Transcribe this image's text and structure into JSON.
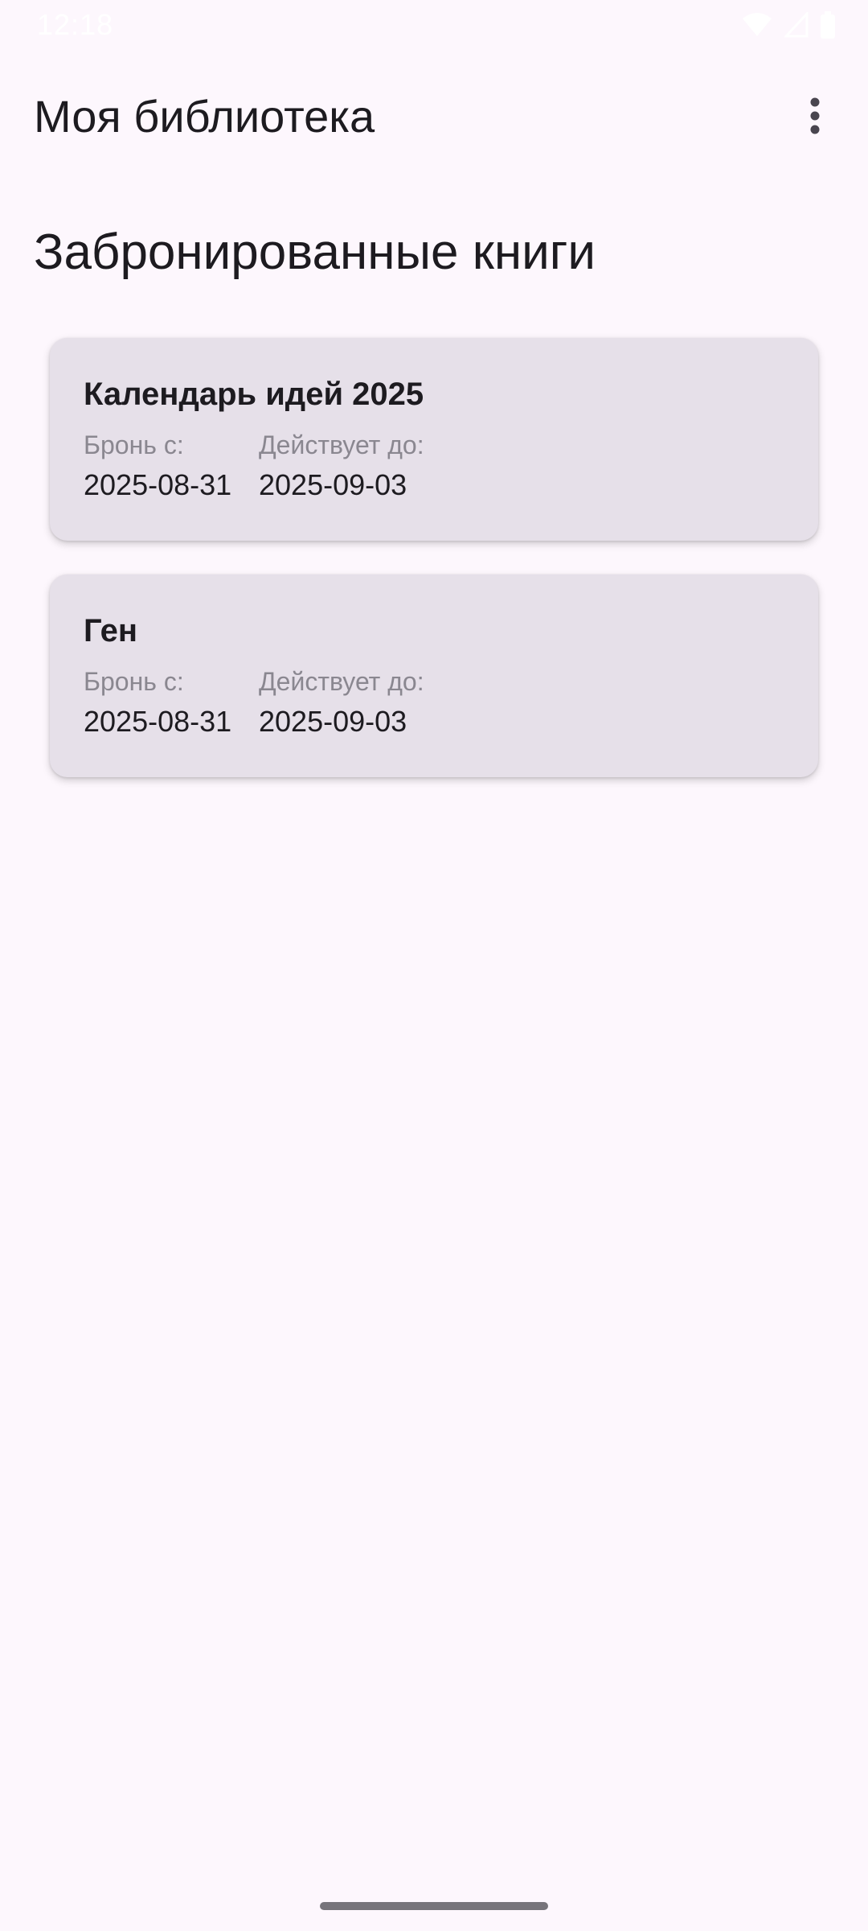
{
  "status_bar": {
    "time": "12:18",
    "icons": [
      "wifi-icon",
      "signal-icon",
      "battery-icon"
    ]
  },
  "app_bar": {
    "title": "Моя библиотека",
    "menu_icon": "more-vert-icon"
  },
  "section": {
    "title": "Забронированные книги"
  },
  "bookings": [
    {
      "title": "Календарь идей 2025",
      "from_label": "Бронь с:",
      "from_value": "2025-08-31",
      "until_label": "Действует до:",
      "until_value": "2025-09-03"
    },
    {
      "title": "Ген",
      "from_label": "Бронь с:",
      "from_value": "2025-08-31",
      "until_label": "Действует до:",
      "until_value": "2025-09-03"
    }
  ],
  "colors": {
    "background": "#fdf7fd",
    "card": "#e6e0e9",
    "text_primary": "#1d1b20",
    "text_secondary": "#8a8790"
  }
}
